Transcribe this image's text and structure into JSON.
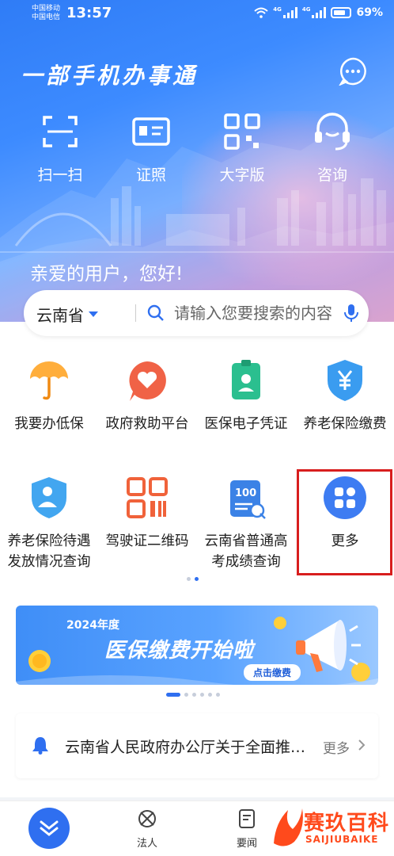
{
  "status_bar": {
    "carrier_1": "中国移动",
    "carrier_2": "中国电信",
    "time": "13:57",
    "net_1": "4G",
    "net_2": "4G",
    "battery": "69%"
  },
  "header": {
    "app_title": "一部手机办事通",
    "quick_actions": [
      {
        "label": "扫一扫",
        "icon": "scan-icon"
      },
      {
        "label": "证照",
        "icon": "id-card-icon"
      },
      {
        "label": "大字版",
        "icon": "qr-grid-icon"
      },
      {
        "label": "咨询",
        "icon": "headset-icon"
      }
    ],
    "greeting": "亲爱的用户，您好!"
  },
  "search": {
    "region": "云南省",
    "placeholder": "请输入您要搜索的内容"
  },
  "services": [
    {
      "label": "我要办低保",
      "icon": "umbrella-icon"
    },
    {
      "label": "政府救助平台",
      "icon": "heart-chat-icon"
    },
    {
      "label": "医保电子凭证",
      "icon": "medical-badge-icon"
    },
    {
      "label": "养老保险缴费",
      "icon": "yuan-shield-icon"
    },
    {
      "label": "养老保险待遇发放情况查询",
      "icon": "elder-shield-icon"
    },
    {
      "label": "驾驶证二维码",
      "icon": "qr-code-icon"
    },
    {
      "label": "云南省普通高考成绩查询",
      "icon": "score-doc-icon"
    },
    {
      "label": "更多",
      "icon": "more-apps-icon"
    }
  ],
  "banner": {
    "year": "2024年度",
    "title": "医保缴费开始啦",
    "cta": "点击缴费"
  },
  "notice": {
    "text": "云南省人民政府办公厅关于全面推进…",
    "more": "更多"
  },
  "bottom_nav": [
    {
      "label": "",
      "icon": "home-icon"
    },
    {
      "label": "法人",
      "icon": "legal-person-icon"
    },
    {
      "label": "要闻",
      "icon": "news-icon"
    }
  ],
  "watermark": {
    "cn": "赛玖百科",
    "en": "SAIJIUBAIKE"
  },
  "colors": {
    "accent": "#2f6ff0",
    "highlight_border": "#d81e1e",
    "watermark": "#ff4a1c"
  }
}
